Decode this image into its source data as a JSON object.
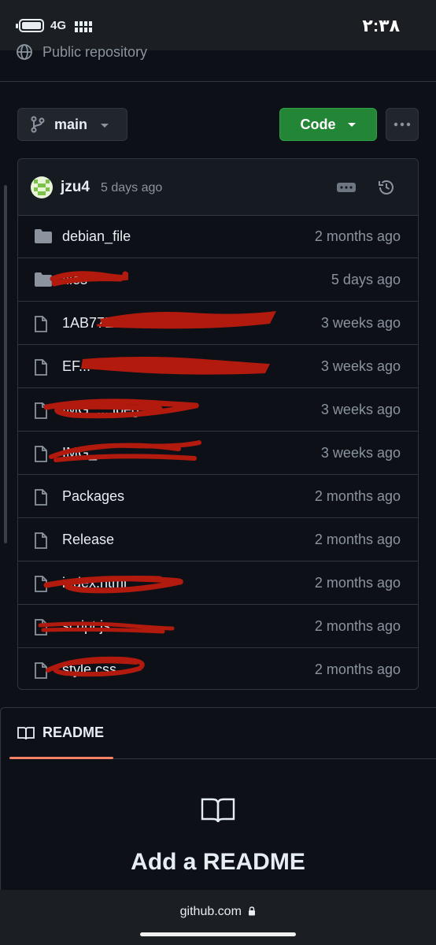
{
  "status_bar": {
    "network": "4G",
    "time": "٢:٣٨"
  },
  "repo": {
    "visibility": "Public repository"
  },
  "toolbar": {
    "branch": "main",
    "code_label": "Code"
  },
  "commit": {
    "user": "jzu4",
    "time": "5 days ago"
  },
  "files": [
    {
      "name": "debian_file",
      "type": "folder",
      "date": "2 months ago"
    },
    {
      "name": "files",
      "type": "folder",
      "date": "5 days ago"
    },
    {
      "name": "1AB77E9...DD...",
      "type": "file",
      "date": "3 weeks ago"
    },
    {
      "name": "EF...",
      "type": "file",
      "date": "3 weeks ago"
    },
    {
      "name": "IMG_....jpeg",
      "type": "file",
      "date": "3 weeks ago"
    },
    {
      "name": "IMG_...",
      "type": "file",
      "date": "3 weeks ago"
    },
    {
      "name": "Packages",
      "type": "file",
      "date": "2 months ago"
    },
    {
      "name": "Release",
      "type": "file",
      "date": "2 months ago"
    },
    {
      "name": "index.html",
      "type": "file",
      "date": "2 months ago"
    },
    {
      "name": "script.js",
      "type": "file",
      "date": "2 months ago"
    },
    {
      "name": "style.css",
      "type": "file",
      "date": "2 months ago"
    }
  ],
  "readme": {
    "tab_label": "README",
    "empty_title": "Add a README"
  },
  "browser": {
    "url": "github.com"
  },
  "colors": {
    "background": "#0d1117",
    "accent_green": "#238636",
    "tab_underline": "#f78166",
    "redaction": "#b31a0e"
  }
}
